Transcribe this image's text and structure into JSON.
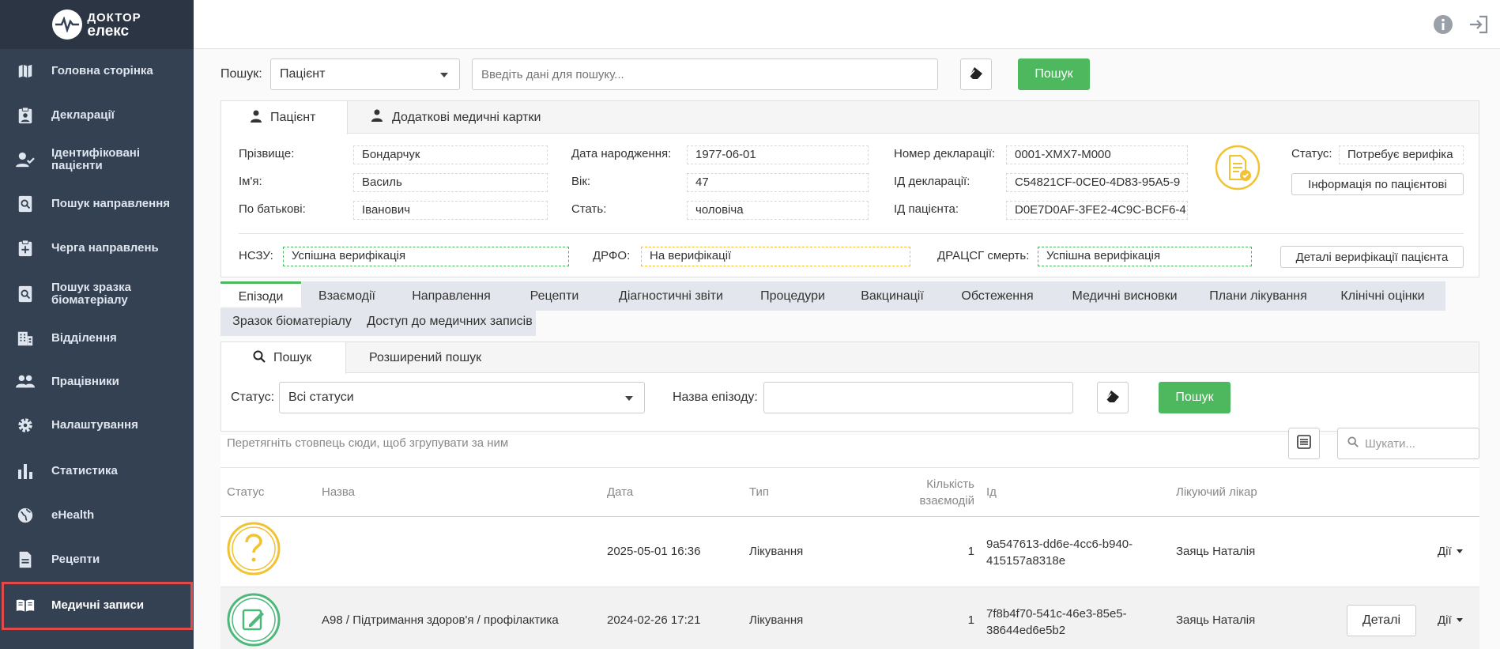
{
  "brand": {
    "line1": "ДОКТОР",
    "line2": "ЕЛЕКС"
  },
  "sidebar": {
    "items": [
      {
        "label": "Головна сторінка",
        "icon": "map-icon"
      },
      {
        "label": "Декларації",
        "icon": "clipboard-user-icon"
      },
      {
        "label": "Ідентифіковані пацієнти",
        "icon": "user-check-icon"
      },
      {
        "label": "Пошук направлення",
        "icon": "search-document-icon"
      },
      {
        "label": "Черга направлень",
        "icon": "clipboard-queue-icon"
      },
      {
        "label": "Пошук зразка",
        "label2": "біоматеріалу",
        "icon": "search-sample-icon"
      },
      {
        "label": "Відділення",
        "icon": "building-icon"
      },
      {
        "label": "Працівники",
        "icon": "people-icon"
      },
      {
        "label": "Налаштування",
        "icon": "gear-icon"
      },
      {
        "label": "Статистика",
        "icon": "bar-chart-icon"
      },
      {
        "label": "eHealth",
        "icon": "globe-icon"
      },
      {
        "label": "Рецепти",
        "icon": "document-icon"
      },
      {
        "label": "Медичні записи",
        "icon": "book-icon"
      }
    ]
  },
  "search": {
    "label": "Пошук:",
    "type_value": "Пацієнт",
    "placeholder": "Введіть дані для пошуку...",
    "button": "Пошук"
  },
  "patient_tabs": [
    "Пацієнт",
    "Додаткові медичні картки"
  ],
  "patient": {
    "surname_label": "Прізвище:",
    "surname": "Бондарчук",
    "name_label": "Ім'я:",
    "name": "Василь",
    "patronymic_label": "По батькові:",
    "patronymic": "Іванович",
    "dob_label": "Дата народження:",
    "dob": "1977-06-01",
    "age_label": "Вік:",
    "age": "47",
    "sex_label": "Стать:",
    "sex": "чоловіча",
    "decl_no_label": "Номер декларації:",
    "decl_no": "0001-XMX7-M000",
    "decl_id_label": "ІД декларації:",
    "decl_id": "C54821CF-0CE0-4D83-95A5-9",
    "patient_id_label": "ІД пацієнта:",
    "patient_id": "D0E7D0AF-3FE2-4C9C-BCF6-4",
    "status_label": "Статус:",
    "status": "Потребує верифіка",
    "info_button": "Інформація по пацієнтові",
    "nszu_label": "НСЗУ:",
    "nszu": "Успішна верифікація",
    "drfo_label": "ДРФО:",
    "drfo": "На верифікації",
    "dracs_label": "ДРАЦСГ смерть:",
    "dracs": "Успішна верифікація",
    "verify_button": "Деталі верифікації пацієнта"
  },
  "record_tabs": [
    "Епізоди",
    "Взаємодії",
    "Направлення",
    "Рецепти",
    "Діагностичні звіти",
    "Процедури",
    "Вакцинації",
    "Обстеження",
    "Медичні висновки",
    "Плани лікування",
    "Клінічні оцінки",
    "Зразок біоматеріалу",
    "Доступ до медичних записів"
  ],
  "search_tabs": [
    "Пошук",
    "Розширений пошук"
  ],
  "filter": {
    "status_label": "Статус:",
    "status_value": "Всі статуси",
    "name_label": "Назва епізоду:",
    "button": "Пошук"
  },
  "grid": {
    "group_hint": "Перетягніть стовпець сюди, щоб згрупувати за ним",
    "search_placeholder": "Шукати...",
    "columns": [
      "Статус",
      "Назва",
      "Дата",
      "Тип",
      "Кількість",
      "взаємодій",
      "Ід",
      "Лікуючий лікар"
    ],
    "rows": [
      {
        "name": "",
        "date": "2025-05-01 16:36",
        "type": "Лікування",
        "count": "1",
        "id1": "9a547613-dd6e-4cc6-b940-",
        "id2": "415157a8318e",
        "doctor": "Заяць Наталія",
        "actions": "Дії",
        "details": ""
      },
      {
        "name": "A98 / Підтримання здоров'я / профілактика",
        "date": "2024-02-26 17:21",
        "type": "Лікування",
        "count": "1",
        "id1": "7f8b4f70-541c-46e3-85e5-",
        "id2": "38644ed6e5b2",
        "doctor": "Заяць Наталія",
        "actions": "Дії",
        "details": "Деталі"
      }
    ]
  }
}
